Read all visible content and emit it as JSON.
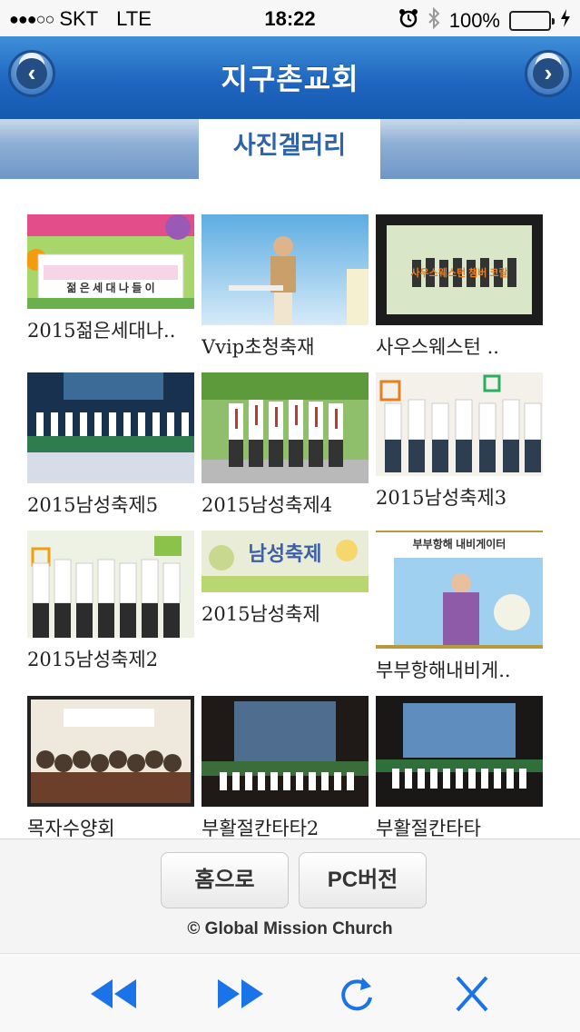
{
  "status": {
    "signal": "●●●○○",
    "carrier": "SKT",
    "network": "LTE",
    "time": "18:22",
    "battery": "100%"
  },
  "header": {
    "title": "지구촌교회",
    "prev_icon": "chevron-left-icon",
    "next_icon": "chevron-right-icon"
  },
  "subheader": {
    "title": "사진겔러리"
  },
  "gallery": {
    "items": [
      {
        "caption": "2015젊은세대나..",
        "thumb_text": "젊 은 세 대 나 들 이"
      },
      {
        "caption": "Vvip초청축재"
      },
      {
        "caption": "사우스웨스턴 ..",
        "thumb_text": "사우스웨스턴 챔버 코랄"
      },
      {
        "caption": "2015남성축제5"
      },
      {
        "caption": "2015남성축제4"
      },
      {
        "caption": "2015남성축제3"
      },
      {
        "caption": "2015남성축제2"
      },
      {
        "caption": "2015남성축제",
        "thumb_text": "남성축제"
      },
      {
        "caption": "부부항해내비게..",
        "thumb_text": "부부항해 내비게이터"
      },
      {
        "caption": "목자수양회"
      },
      {
        "caption": "부활절칸타타2"
      },
      {
        "caption": "부활절칸타타"
      }
    ]
  },
  "footer": {
    "home_label": "홈으로",
    "pc_label": "PC버전",
    "copyright": "© Global Mission Church"
  },
  "toolbar": {
    "back_icon": "rewind-icon",
    "forward_icon": "fast-forward-icon",
    "reload_icon": "reload-icon",
    "close_icon": "close-icon",
    "accent": "#1a73e8"
  }
}
